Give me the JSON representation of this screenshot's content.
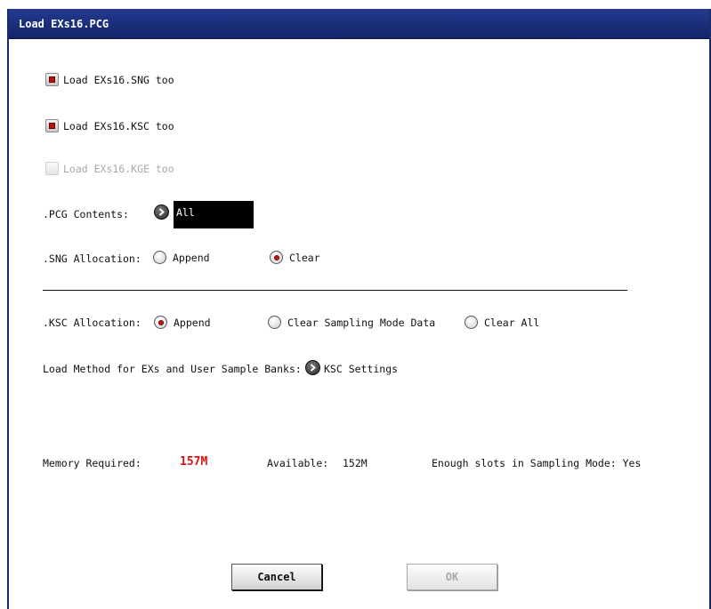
{
  "dialog": {
    "title": "Load EXs16.PCG"
  },
  "options": {
    "load_sng": {
      "label": "Load EXs16.SNG too",
      "checked": true
    },
    "load_ksc": {
      "label": "Load EXs16.KSC too",
      "checked": true
    },
    "load_kge": {
      "label": "Load EXs16.KGE too",
      "checked": false,
      "enabled": false
    }
  },
  "pcg_contents": {
    "label": ".PCG Contents:",
    "value": "All"
  },
  "sng_allocation": {
    "label": ".SNG Allocation:",
    "options": [
      "Append",
      "Clear"
    ],
    "selected": "Clear"
  },
  "ksc_allocation": {
    "label": ".KSC Allocation:",
    "options": [
      "Append",
      "Clear Sampling Mode Data",
      "Clear All"
    ],
    "selected": "Append"
  },
  "load_method": {
    "label": "Load Method for EXs and User Sample Banks:",
    "value": "KSC Settings"
  },
  "memory": {
    "required_label": "Memory Required:",
    "required_value": "157M",
    "available_label": "Available:",
    "available_value": "152M",
    "slots_text": "Enough slots in Sampling Mode: Yes"
  },
  "buttons": {
    "cancel": "Cancel",
    "ok": "OK"
  },
  "colors": {
    "title_bar": "#1a2e7e",
    "required_value": "#e01010",
    "selection_mark": "#b31414"
  }
}
